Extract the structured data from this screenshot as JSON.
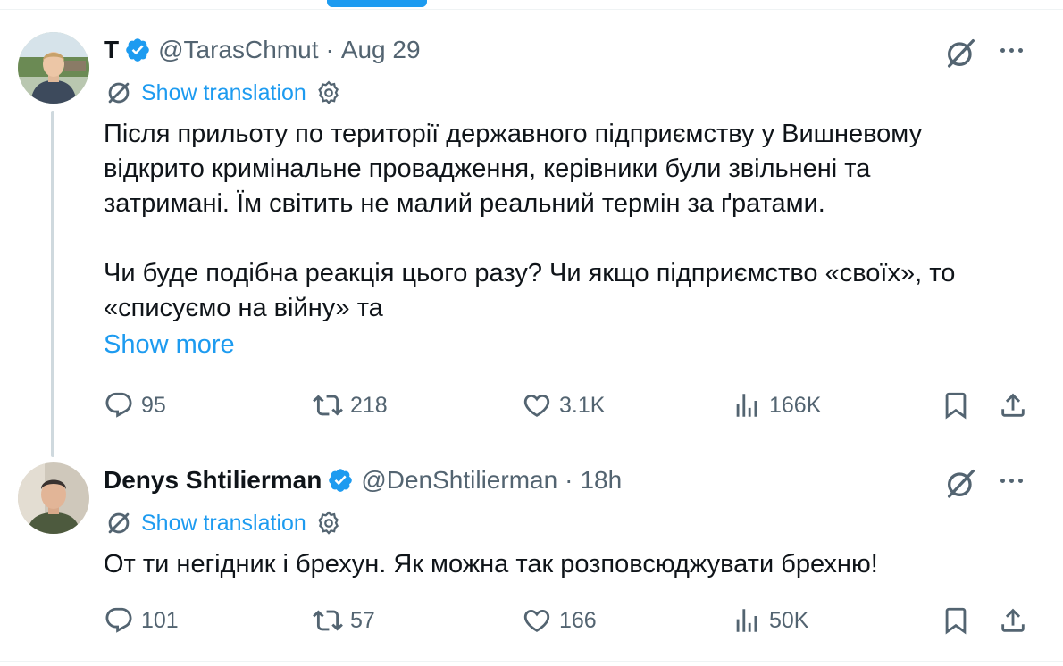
{
  "colors": {
    "accent": "#1d9bf0",
    "secondary_text": "#536471",
    "thread_line": "#cfd9de"
  },
  "tweets": [
    {
      "name": "T",
      "handle": "@TarasChmut",
      "separator": "·",
      "time": "Aug 29",
      "verified": true,
      "translate_label": "Show translation",
      "paragraphs": [
        [
          "Після прильоту по території державного підприємству у Вишневому",
          "відкрито кримінальне провадження, керівники були звільнені та",
          "затримані. Їм світить не малий реальний термін за ґратами."
        ],
        [
          "Чи буде подібна реакція цього разу? Чи якщо підприємство «своїх», то",
          "«списуємо на війну» та"
        ]
      ],
      "show_more": "Show more",
      "stats": {
        "replies": "95",
        "reposts": "218",
        "likes": "3.1K",
        "views": "166K"
      }
    },
    {
      "name": "Denys Shtilierman",
      "handle": "@DenShtilierman",
      "separator": "·",
      "time": "18h",
      "verified": true,
      "translate_label": "Show translation",
      "paragraphs": [
        [
          "От ти негідник і брехун. Як можна так розповсюджувати брехню!"
        ]
      ],
      "stats": {
        "replies": "101",
        "reposts": "57",
        "likes": "166",
        "views": "50K"
      }
    }
  ],
  "icons": [
    "reply-icon",
    "repost-icon",
    "like-icon",
    "views-icon",
    "bookmark-icon",
    "share-icon",
    "grok-icon",
    "more-icon",
    "translate-icon",
    "settings-icon",
    "verified-icon"
  ]
}
